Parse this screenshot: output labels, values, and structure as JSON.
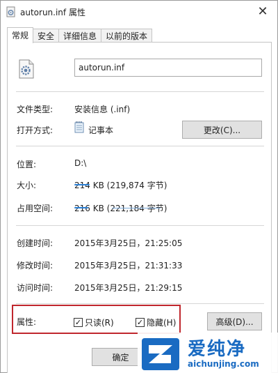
{
  "window": {
    "title": "autorun.inf 属性",
    "close_glyph": "✕"
  },
  "tabs": [
    {
      "label": "常规"
    },
    {
      "label": "安全"
    },
    {
      "label": "详细信息"
    },
    {
      "label": "以前的版本"
    }
  ],
  "file": {
    "name": "autorun.inf"
  },
  "fields": {
    "type_label": "文件类型:",
    "type_value": "安装信息 (.inf)",
    "open_label": "打开方式:",
    "open_value": "记事本",
    "change_button": "更改(C)...",
    "location_label": "位置:",
    "location_value": "D:\\",
    "size_label": "大小:",
    "size_value": "214 KB (219,874 字节)",
    "disk_label": "占用空间:",
    "disk_value": "216 KB (221,184 字节)",
    "created_label": "创建时间:",
    "created_value": "2015年3月25日，21:25:05",
    "modified_label": "修改时间:",
    "modified_value": "2015年3月25日，21:31:33",
    "accessed_label": "访问时间:",
    "accessed_value": "2015年3月25日，21:29:15"
  },
  "attributes": {
    "label": "属性:",
    "readonly_label": "只读(R)",
    "readonly_checked": true,
    "hidden_label": "隐藏(H)",
    "hidden_checked": true,
    "advanced_button": "高级(D)..."
  },
  "footer": {
    "ok_button": "确定"
  },
  "watermark": {
    "text": "爱纯净",
    "url": "aichunjing.com"
  },
  "colors": {
    "highlight": "#c0272d",
    "watermark": "#1a6bc2"
  }
}
